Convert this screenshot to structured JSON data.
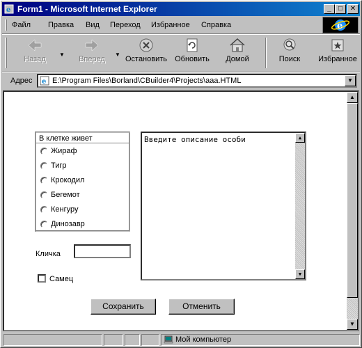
{
  "window": {
    "title": "Form1 - Microsoft Internet Explorer",
    "controls": {
      "minimize": "_",
      "maximize": "□",
      "close": "✕"
    }
  },
  "menu": {
    "items": [
      "Файл",
      "Правка",
      "Вид",
      "Переход",
      "Избранное",
      "Справка"
    ]
  },
  "toolbar": {
    "back": "Назад",
    "forward": "Вперед",
    "stop": "Остановить",
    "refresh": "Обновить",
    "home": "Домой",
    "search": "Поиск",
    "favorites": "Избранное"
  },
  "address": {
    "label": "Адрес",
    "url": "E:\\Program Files\\Borland\\CBuilder4\\Projects\\aaa.HTML"
  },
  "form": {
    "group_legend": "В клетке живет",
    "animals": [
      "Жираф",
      "Тигр",
      "Крокодил",
      "Бегемот",
      "Кенгуру",
      "Динозавр"
    ],
    "description": "Введите описание особи",
    "nickname_label": "Кличка",
    "nickname_value": "",
    "male_label": "Самец",
    "male_checked": false,
    "save_label": "Сохранить",
    "cancel_label": "Отменить"
  },
  "status": {
    "zone": "Мой компьютер"
  }
}
